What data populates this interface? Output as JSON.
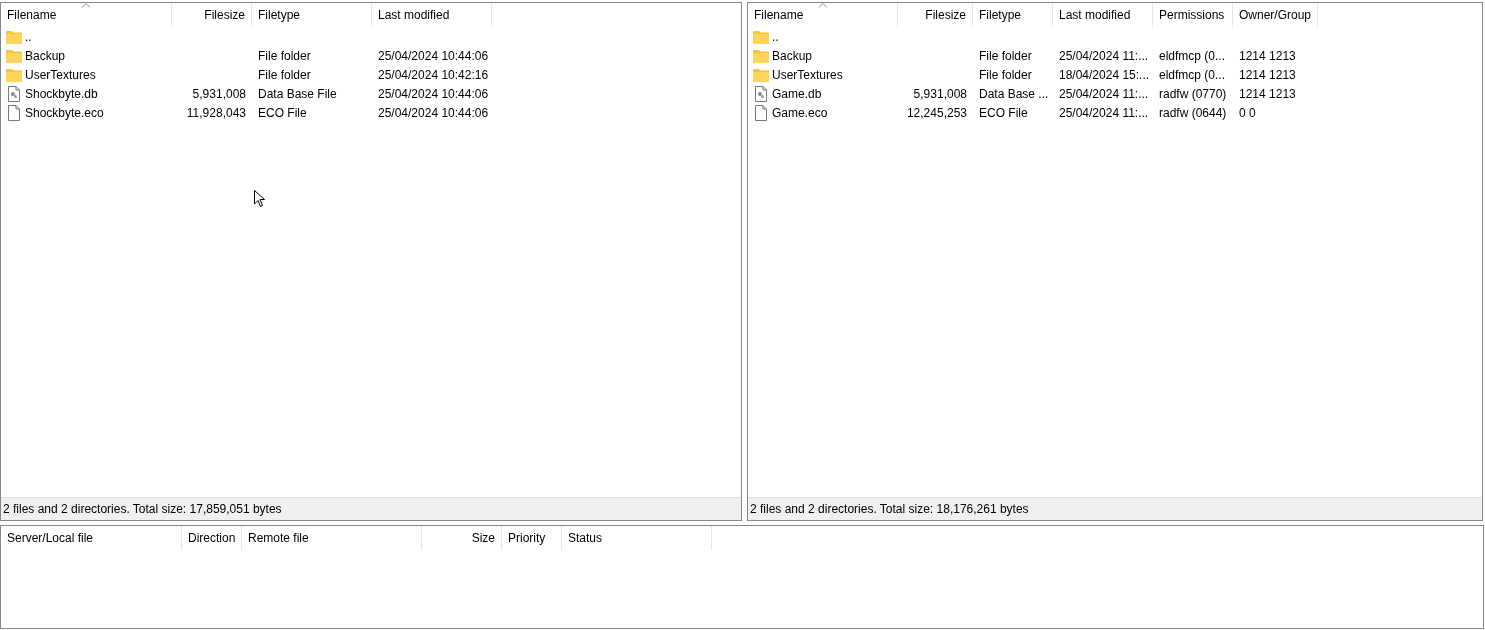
{
  "local_pane": {
    "columns": [
      {
        "label": "Filename",
        "kind": "text",
        "sorted": true
      },
      {
        "label": "Filesize",
        "kind": "number",
        "sorted": false
      },
      {
        "label": "Filetype",
        "kind": "text",
        "sorted": false
      },
      {
        "label": "Last modified",
        "kind": "text",
        "sorted": false
      }
    ],
    "rows": [
      {
        "kind": "folder",
        "cells": [
          "..",
          "",
          "",
          ""
        ]
      },
      {
        "kind": "folder",
        "cells": [
          "Backup",
          "",
          "File folder",
          "25/04/2024 10:44:06"
        ]
      },
      {
        "kind": "folder",
        "cells": [
          "UserTextures",
          "",
          "File folder",
          "25/04/2024 10:42:16"
        ]
      },
      {
        "kind": "database",
        "cells": [
          "Shockbyte.db",
          "5,931,008",
          "Data Base File",
          "25/04/2024 10:44:06"
        ]
      },
      {
        "kind": "file",
        "cells": [
          "Shockbyte.eco",
          "11,928,043",
          "ECO File",
          "25/04/2024 10:44:06"
        ]
      }
    ],
    "status": "2 files and 2 directories. Total size: 17,859,051 bytes"
  },
  "remote_pane": {
    "columns": [
      {
        "label": "Filename",
        "kind": "text",
        "sorted": true
      },
      {
        "label": "Filesize",
        "kind": "number",
        "sorted": false
      },
      {
        "label": "Filetype",
        "kind": "text",
        "sorted": false
      },
      {
        "label": "Last modified",
        "kind": "text",
        "sorted": false
      },
      {
        "label": "Permissions",
        "kind": "text",
        "sorted": false
      },
      {
        "label": "Owner/Group",
        "kind": "text",
        "sorted": false
      }
    ],
    "rows": [
      {
        "kind": "folder",
        "cells": [
          "..",
          "",
          "",
          "",
          "",
          ""
        ]
      },
      {
        "kind": "folder",
        "cells": [
          "Backup",
          "",
          "File folder",
          "25/04/2024 11:...",
          "eldfmcp (0...",
          "1214 1213"
        ]
      },
      {
        "kind": "folder",
        "cells": [
          "UserTextures",
          "",
          "File folder",
          "18/04/2024 15:...",
          "eldfmcp (0...",
          "1214 1213"
        ]
      },
      {
        "kind": "database",
        "cells": [
          "Game.db",
          "5,931,008",
          "Data Base ...",
          "25/04/2024 11:...",
          "radfw (0770)",
          "1214 1213"
        ]
      },
      {
        "kind": "file",
        "cells": [
          "Game.eco",
          "12,245,253",
          "ECO File",
          "25/04/2024 11:...",
          "radfw (0644)",
          "0 0"
        ]
      }
    ],
    "status": "2 files and 2 directories. Total size: 18,176,261 bytes"
  },
  "queue": {
    "columns": [
      {
        "label": "Server/Local file",
        "kind": "text"
      },
      {
        "label": "Direction",
        "kind": "text"
      },
      {
        "label": "Remote file",
        "kind": "text"
      },
      {
        "label": "Size",
        "kind": "number"
      },
      {
        "label": "Priority",
        "kind": "text"
      },
      {
        "label": "Status",
        "kind": "text"
      }
    ]
  }
}
